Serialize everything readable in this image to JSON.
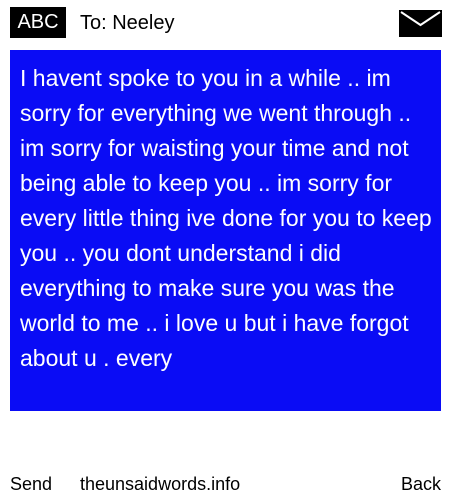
{
  "header": {
    "mode_badge": "ABC",
    "recipient": "To: Neeley",
    "icon": "envelope-icon"
  },
  "message": {
    "text": "I havent spoke to you in a while .. im sorry for everything we went through .. im sorry for waisting your time and not being able to keep you .. im sorry for every little thing ive done for you to keep you .. you dont understand i did everything to make sure you was the world to me .. i love u but i have forgot about u . every"
  },
  "footer": {
    "send_label": "Send",
    "site_label": "theunsaidwords.info",
    "back_label": "Back"
  },
  "colors": {
    "message_background": "#0a0cf5",
    "message_text": "#ffffff",
    "badge_background": "#000000"
  }
}
